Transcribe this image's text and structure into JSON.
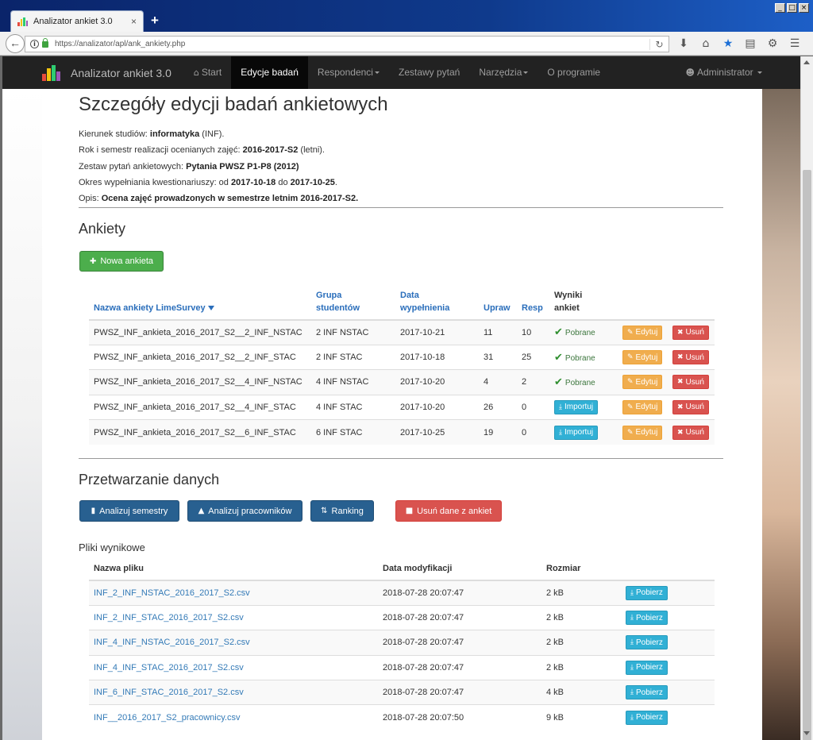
{
  "browser": {
    "tab_title": "Analizator ankiet 3.0",
    "tab_close": "×",
    "new_tab": "+",
    "url": "https://analizator/apl/ank_ankiety.php",
    "window_buttons": [
      "_",
      "□",
      "×"
    ],
    "toolbar_icons": [
      "download-icon",
      "home-icon",
      "bookmark-star-icon",
      "clipboard-icon",
      "extension-icon",
      "menu-icon"
    ]
  },
  "nav": {
    "brand": "Analizator ankiet 3.0",
    "items": [
      {
        "label": "Start",
        "icon": "home-icon"
      },
      {
        "label": "Edycje badań",
        "active": true
      },
      {
        "label": "Respondenci",
        "dropdown": true
      },
      {
        "label": "Zestawy pytań"
      },
      {
        "label": "Narzędzia",
        "dropdown": true
      },
      {
        "label": "O programie"
      }
    ],
    "user": "Administrator"
  },
  "page": {
    "title": "Szczegóły edycji badań ankietowych",
    "info": {
      "kierunek_label": "Kierunek studiów: ",
      "kierunek_value": "informatyka",
      "kierunek_suffix": " (INF).",
      "rok_label": "Rok i semestr realizacji ocenianych zajęć: ",
      "rok_value": "2016-2017-S2",
      "rok_suffix": " (letni).",
      "zestaw_label": "Zestaw pytań ankietowych: ",
      "zestaw_value": "Pytania PWSZ P1-P8 (2012)",
      "okres_label": "Okres wypełniania kwestionariuszy: od ",
      "okres_from": "2017-10-18",
      "okres_mid": " do ",
      "okres_to": "2017-10-25",
      "okres_suffix": ".",
      "opis_label": "Opis: ",
      "opis_value": "Ocena zajęć prowadzonych w semestrze letnim 2016-2017-S2."
    }
  },
  "ankiety": {
    "heading": "Ankiety",
    "new_button": "Nowa ankieta",
    "columns": {
      "nazwa": "Nazwa ankiety LimeSurvey",
      "grupa_1": "Grupa",
      "grupa_2": "studentów",
      "data_1": "Data",
      "data_2": "wypełnienia",
      "upraw": "Upraw",
      "resp": "Resp",
      "wyniki_1": "Wyniki",
      "wyniki_2": "ankiet"
    },
    "labels": {
      "pobrane": "Pobrane",
      "importuj": "Importuj",
      "edytuj": "Edytuj",
      "usun": "Usuń"
    },
    "rows": [
      {
        "nazwa": "PWSZ_INF_ankieta_2016_2017_S2__2_INF_NSTAC",
        "grupa": "2 INF NSTAC",
        "data": "2017-10-21",
        "upraw": "11",
        "resp": "10",
        "status": "Pobrane"
      },
      {
        "nazwa": "PWSZ_INF_ankieta_2016_2017_S2__2_INF_STAC",
        "grupa": "2 INF STAC",
        "data": "2017-10-18",
        "upraw": "31",
        "resp": "25",
        "status": "Pobrane"
      },
      {
        "nazwa": "PWSZ_INF_ankieta_2016_2017_S2__4_INF_NSTAC",
        "grupa": "4 INF NSTAC",
        "data": "2017-10-20",
        "upraw": "4",
        "resp": "2",
        "status": "Pobrane"
      },
      {
        "nazwa": "PWSZ_INF_ankieta_2016_2017_S2__4_INF_STAC",
        "grupa": "4 INF STAC",
        "data": "2017-10-20",
        "upraw": "26",
        "resp": "0",
        "status": "Importuj"
      },
      {
        "nazwa": "PWSZ_INF_ankieta_2016_2017_S2__6_INF_STAC",
        "grupa": "6 INF STAC",
        "data": "2017-10-25",
        "upraw": "19",
        "resp": "0",
        "status": "Importuj"
      }
    ]
  },
  "przetwarzanie": {
    "heading": "Przetwarzanie danych",
    "buttons": {
      "semestry": "Analizuj semestry",
      "pracownicy": "Analizuj pracowników",
      "ranking": "Ranking",
      "usun": "Usuń dane z ankiet"
    }
  },
  "pliki": {
    "heading": "Pliki wynikowe",
    "columns": {
      "nazwa": "Nazwa pliku",
      "data": "Data modyfikacji",
      "rozmiar": "Rozmiar"
    },
    "download_label": "Pobierz",
    "rows": [
      {
        "nazwa": "INF_2_INF_NSTAC_2016_2017_S2.csv",
        "data": "2018-07-28 20:07:47",
        "rozmiar": "2 kB"
      },
      {
        "nazwa": "INF_2_INF_STAC_2016_2017_S2.csv",
        "data": "2018-07-28 20:07:47",
        "rozmiar": "2 kB"
      },
      {
        "nazwa": "INF_4_INF_NSTAC_2016_2017_S2.csv",
        "data": "2018-07-28 20:07:47",
        "rozmiar": "2 kB"
      },
      {
        "nazwa": "INF_4_INF_STAC_2016_2017_S2.csv",
        "data": "2018-07-28 20:07:47",
        "rozmiar": "2 kB"
      },
      {
        "nazwa": "INF_6_INF_STAC_2016_2017_S2.csv",
        "data": "2018-07-28 20:07:47",
        "rozmiar": "4 kB"
      },
      {
        "nazwa": "INF__2016_2017_S2_pracownicy.csv",
        "data": "2018-07-28 20:07:50",
        "rozmiar": "9 kB"
      }
    ]
  },
  "colors": {
    "navbar": "#222222",
    "success": "#4cae4c",
    "primary": "#286090",
    "danger": "#d9534f",
    "warning": "#f0ad4e",
    "info": "#31b0d5",
    "link": "#337ab7"
  }
}
